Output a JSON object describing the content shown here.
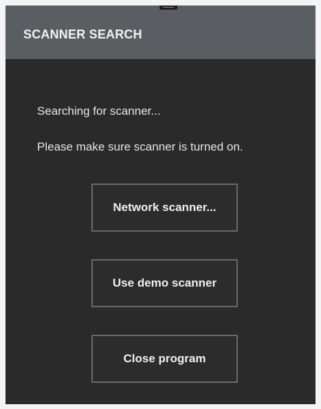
{
  "dialog": {
    "title": "SCANNER SEARCH",
    "messages": [
      "Searching for scanner...",
      "Please make sure scanner is turned on."
    ],
    "buttons": {
      "network": "Network scanner...",
      "demo": "Use demo scanner",
      "close": "Close program"
    }
  },
  "colors": {
    "titlebar": "#5a5d62",
    "background": "#2a2a2a",
    "button_border": "#6a6a6a",
    "text": "#f0f0f0"
  }
}
